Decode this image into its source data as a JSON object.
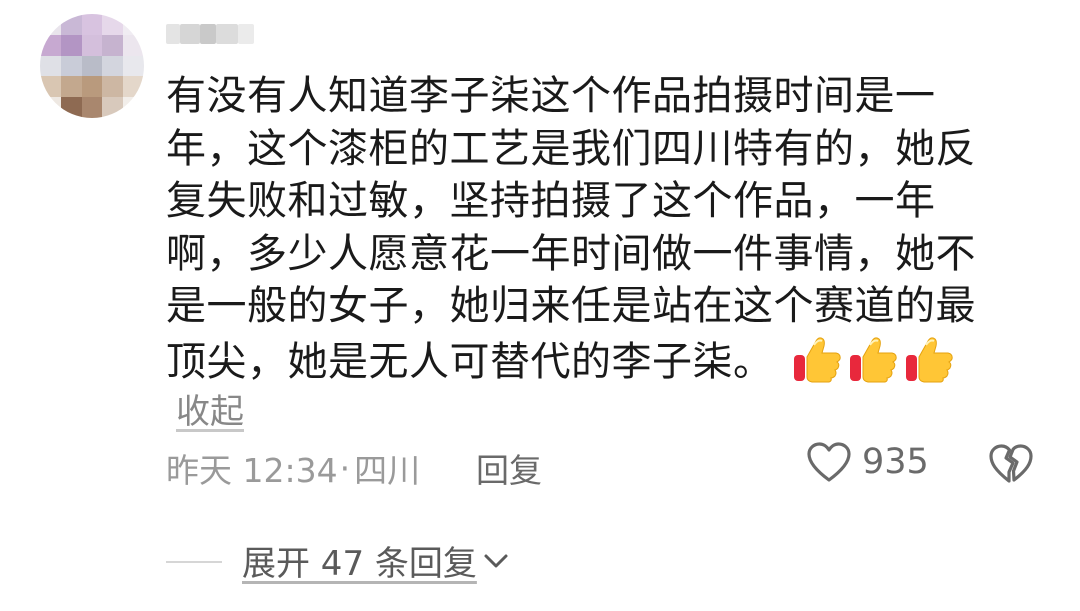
{
  "comment": {
    "lines": [
      "有没有人知道李子柒这个作品拍摄时间是一",
      "年，这个漆柜的工艺是我们四川特有的，她反",
      "复失败和过敏，坚持拍摄了这个作品，一年",
      "啊，多少人愿意花一年时间做一件事情，她不",
      "是一般的女子，她归来任是站在这个赛道的最",
      "顶尖，她是无人可替代的李子柒。"
    ],
    "emoji": [
      "thumbs-up",
      "thumbs-up",
      "thumbs-up"
    ],
    "collapse_label": "收起"
  },
  "meta": {
    "time": "昨天 12:34",
    "location": "四川",
    "separator": "·",
    "reply_label": "回复",
    "like_count": "935"
  },
  "replies": {
    "expand_label": "展开 47 条回复"
  },
  "colors": {
    "text": "#1a1a1a",
    "muted": "#9a9a9a",
    "icon": "#6a6a6a"
  }
}
